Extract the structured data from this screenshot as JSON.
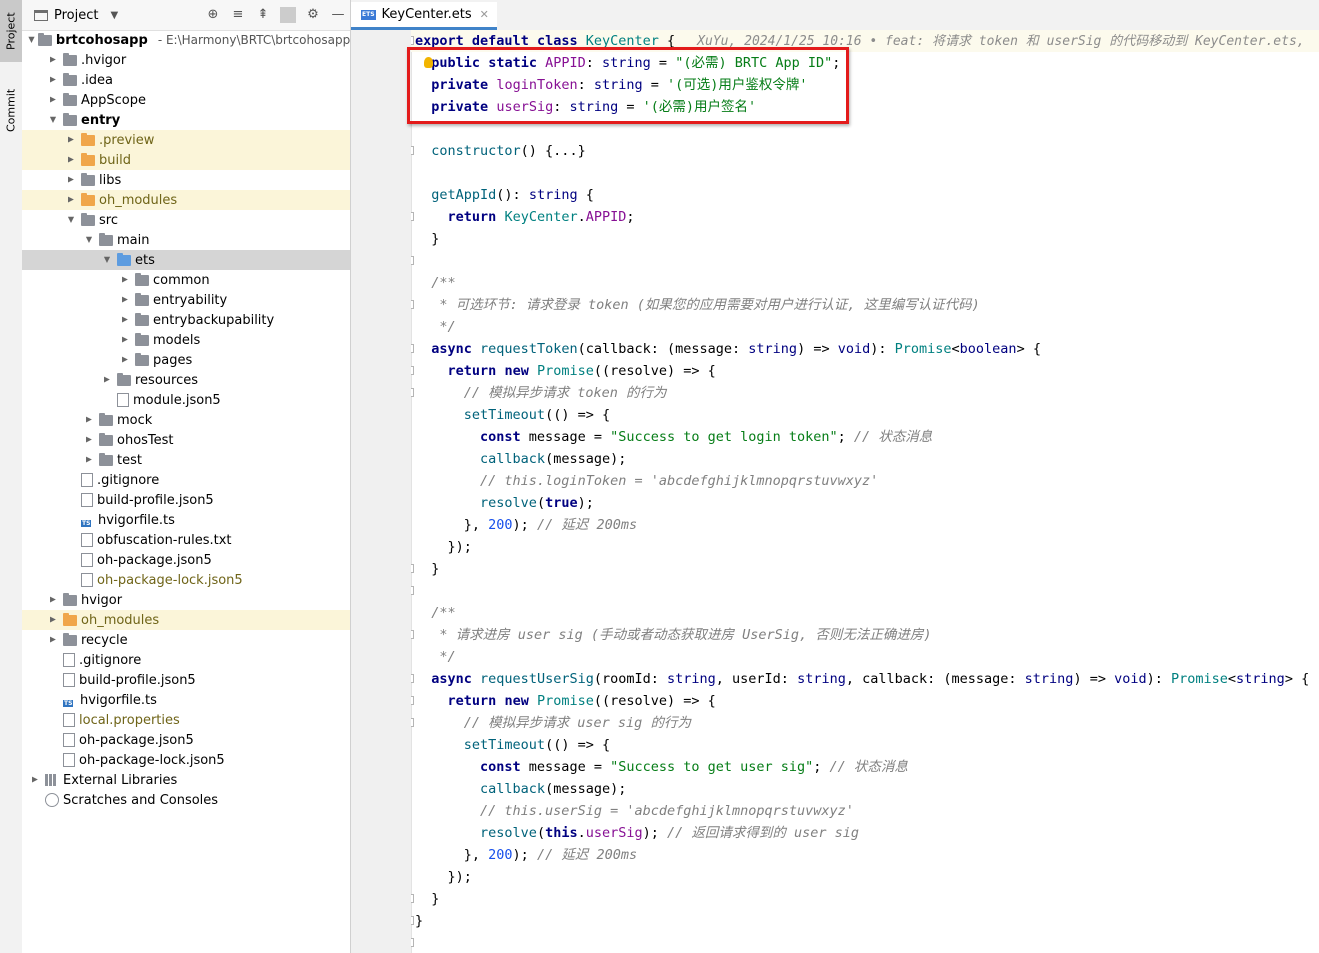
{
  "sidebar": {
    "project_tab": "Project",
    "commit_tab": "Commit"
  },
  "project_panel": {
    "title": "Project",
    "tree": [
      {
        "depth": 0,
        "label": "brtcohosapp",
        "path": "E:\\Harmony\\BRTC\\brtcohosapp",
        "type": "folder",
        "bold": true,
        "expanded": true
      },
      {
        "depth": 1,
        "label": ".hvigor",
        "type": "folder",
        "expanded": false
      },
      {
        "depth": 1,
        "label": ".idea",
        "type": "folder",
        "expanded": false
      },
      {
        "depth": 1,
        "label": "AppScope",
        "type": "folder",
        "expanded": false
      },
      {
        "depth": 1,
        "label": "entry",
        "type": "folder",
        "bold": true,
        "expanded": true
      },
      {
        "depth": 2,
        "label": ".preview",
        "type": "folder-orange",
        "mod": true,
        "highlight": true,
        "expanded": false
      },
      {
        "depth": 2,
        "label": "build",
        "type": "folder-orange",
        "mod": true,
        "highlight": true,
        "expanded": false
      },
      {
        "depth": 2,
        "label": "libs",
        "type": "folder",
        "expanded": false
      },
      {
        "depth": 2,
        "label": "oh_modules",
        "type": "folder-orange",
        "mod": true,
        "highlight": true,
        "expanded": false
      },
      {
        "depth": 2,
        "label": "src",
        "type": "folder",
        "expanded": true
      },
      {
        "depth": 3,
        "label": "main",
        "type": "folder",
        "expanded": true
      },
      {
        "depth": 4,
        "label": "ets",
        "type": "folder-blue",
        "selected": true,
        "expanded": true
      },
      {
        "depth": 5,
        "label": "common",
        "type": "folder",
        "expanded": false
      },
      {
        "depth": 5,
        "label": "entryability",
        "type": "folder",
        "expanded": false
      },
      {
        "depth": 5,
        "label": "entrybackupability",
        "type": "folder",
        "expanded": false
      },
      {
        "depth": 5,
        "label": "models",
        "type": "folder",
        "expanded": false
      },
      {
        "depth": 5,
        "label": "pages",
        "type": "folder",
        "expanded": false
      },
      {
        "depth": 4,
        "label": "resources",
        "type": "folder",
        "expanded": false
      },
      {
        "depth": 4,
        "label": "module.json5",
        "type": "file",
        "leaf": true
      },
      {
        "depth": 3,
        "label": "mock",
        "type": "folder",
        "expanded": false
      },
      {
        "depth": 3,
        "label": "ohosTest",
        "type": "folder",
        "expanded": false
      },
      {
        "depth": 3,
        "label": "test",
        "type": "folder",
        "expanded": false
      },
      {
        "depth": 2,
        "label": ".gitignore",
        "type": "file",
        "leaf": true
      },
      {
        "depth": 2,
        "label": "build-profile.json5",
        "type": "file",
        "leaf": true
      },
      {
        "depth": 2,
        "label": "hvigorfile.ts",
        "type": "ts",
        "leaf": true
      },
      {
        "depth": 2,
        "label": "obfuscation-rules.txt",
        "type": "file",
        "leaf": true
      },
      {
        "depth": 2,
        "label": "oh-package.json5",
        "type": "file",
        "leaf": true
      },
      {
        "depth": 2,
        "label": "oh-package-lock.json5",
        "type": "file",
        "mod": true,
        "leaf": true
      },
      {
        "depth": 1,
        "label": "hvigor",
        "type": "folder",
        "expanded": false
      },
      {
        "depth": 1,
        "label": "oh_modules",
        "type": "folder-orange",
        "mod": true,
        "highlight": true,
        "expanded": false
      },
      {
        "depth": 1,
        "label": "recycle",
        "type": "folder",
        "expanded": false
      },
      {
        "depth": 1,
        "label": ".gitignore",
        "type": "file",
        "leaf": true
      },
      {
        "depth": 1,
        "label": "build-profile.json5",
        "type": "file",
        "leaf": true
      },
      {
        "depth": 1,
        "label": "hvigorfile.ts",
        "type": "ts",
        "leaf": true
      },
      {
        "depth": 1,
        "label": "local.properties",
        "type": "file",
        "mod": true,
        "leaf": true
      },
      {
        "depth": 1,
        "label": "oh-package.json5",
        "type": "file",
        "leaf": true
      },
      {
        "depth": 1,
        "label": "oh-package-lock.json5",
        "type": "file",
        "leaf": true
      },
      {
        "depth": 0,
        "label": "External Libraries",
        "type": "lib",
        "expanded": false
      },
      {
        "depth": 0,
        "label": "Scratches and Consoles",
        "type": "scratch",
        "leaf": true
      }
    ]
  },
  "editor": {
    "tab_label": "KeyCenter.ets",
    "tab_icon_label": "ETS",
    "inline_blame": "XuYu, 2024/1/25 10:16 • feat: 将请求 token 和 userSig 的代码移动到 KeyCenter.ets,",
    "lines": [
      "export default class KeyCenter {",
      "  public static APPID: string = \"(必需) BRTC App ID\";",
      "  private loginToken: string = '(可选)用户鉴权令牌'",
      "  private userSig: string = '(必需)用户签名'",
      "",
      "  constructor() {...}",
      "",
      "  getAppId(): string {",
      "    return KeyCenter.APPID;",
      "  }",
      "",
      "  /**",
      "   * 可选环节: 请求登录 token (如果您的应用需要对用户进行认证, 这里编写认证代码)",
      "   */",
      "  async requestToken(callback: (message: string) => void): Promise<boolean> {",
      "    return new Promise((resolve) => {",
      "      // 模拟异步请求 token 的行为",
      "      setTimeout(() => {",
      "        const message = \"Success to get login token\"; // 状态消息",
      "        callback(message);",
      "        // this.loginToken = 'abcdefghijklmnopqrstuvwxyz'",
      "        resolve(true);",
      "      }, 200); // 延迟 200ms",
      "    });",
      "  }",
      "",
      "  /**",
      "   * 请求进房 user sig (手动或者动态获取进房 UserSig, 否则无法正确进房)",
      "   */",
      "  async requestUserSig(roomId: string, userId: string, callback: (message: string) => void): Promise<string> {",
      "    return new Promise((resolve) => {",
      "      // 模拟异步请求 user sig 的行为",
      "      setTimeout(() => {",
      "        const message = \"Success to get user sig\"; // 状态消息",
      "        callback(message);",
      "        // this.userSig = 'abcdefghijklmnopqrstuvwxyz'",
      "        resolve(this.userSig); // 返回请求得到的 user sig",
      "      }, 200); // 延迟 200ms",
      "    });",
      "  }",
      "}",
      ""
    ]
  },
  "colors": {
    "highlight_box": "#e31b1b",
    "selected_row": "#d5d5d5",
    "modified_row": "#fbf5d9",
    "tab_underline": "#4083c9"
  }
}
